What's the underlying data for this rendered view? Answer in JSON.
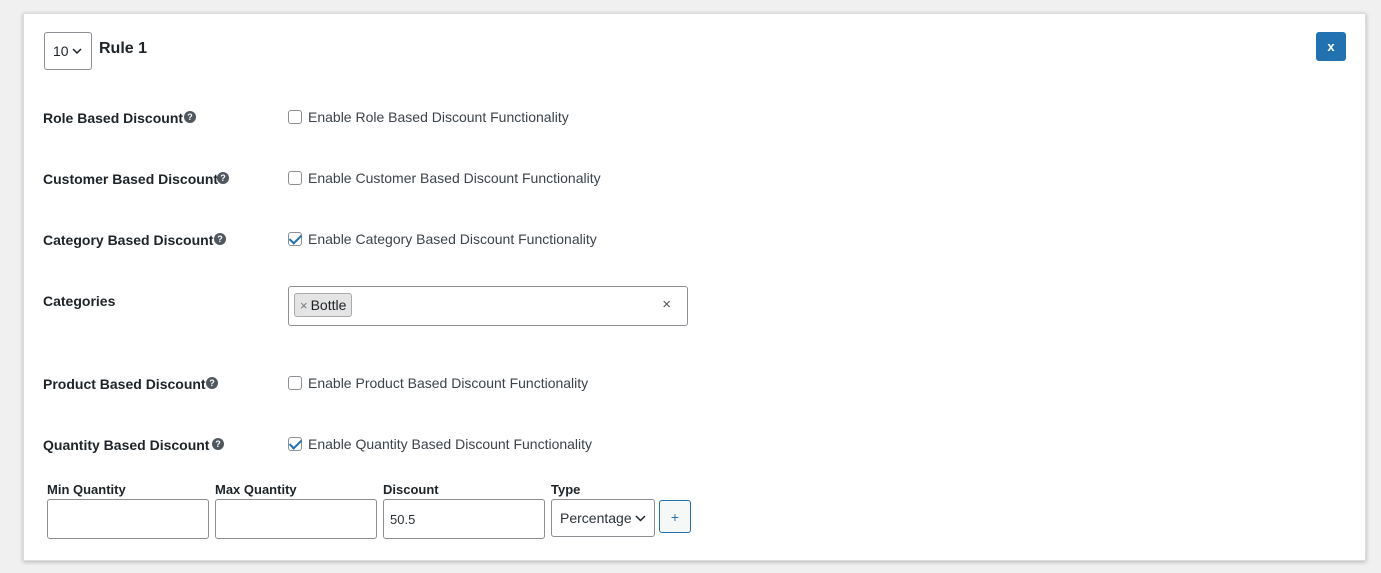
{
  "header": {
    "priority_value": "10",
    "rule_title": "Rule 1",
    "close_label": "x"
  },
  "rows": {
    "role": {
      "label": "Role Based Discount",
      "help": "?",
      "checkbox_label": "Enable Role Based Discount Functionality",
      "checked": false
    },
    "customer": {
      "label": "Customer Based Discount",
      "help": "?",
      "checkbox_label": "Enable Customer Based Discount Functionality",
      "checked": false
    },
    "category": {
      "label": "Category Based Discount",
      "help": "?",
      "checkbox_label": "Enable Category Based Discount Functionality",
      "checked": true
    },
    "categories": {
      "label": "Categories",
      "selected": [
        "Bottle"
      ],
      "chip_remove": "×",
      "clear": "×"
    },
    "product": {
      "label": "Product Based Discount",
      "help": "?",
      "checkbox_label": "Enable Product Based Discount Functionality",
      "checked": false
    },
    "quantity": {
      "label": "Quantity Based Discount",
      "help": "?",
      "checkbox_label": "Enable Quantity Based Discount Functionality",
      "checked": true
    }
  },
  "quantity_table": {
    "min_label": "Min Quantity",
    "max_label": "Max Quantity",
    "discount_label": "Discount",
    "type_label": "Type",
    "min_value": "",
    "max_value": "",
    "discount_value": "50.5",
    "type_value": "Percentage",
    "add_label": "+"
  },
  "colors": {
    "accent": "#2271b1",
    "border": "#8c8f94",
    "background": "#f0f0f1"
  }
}
